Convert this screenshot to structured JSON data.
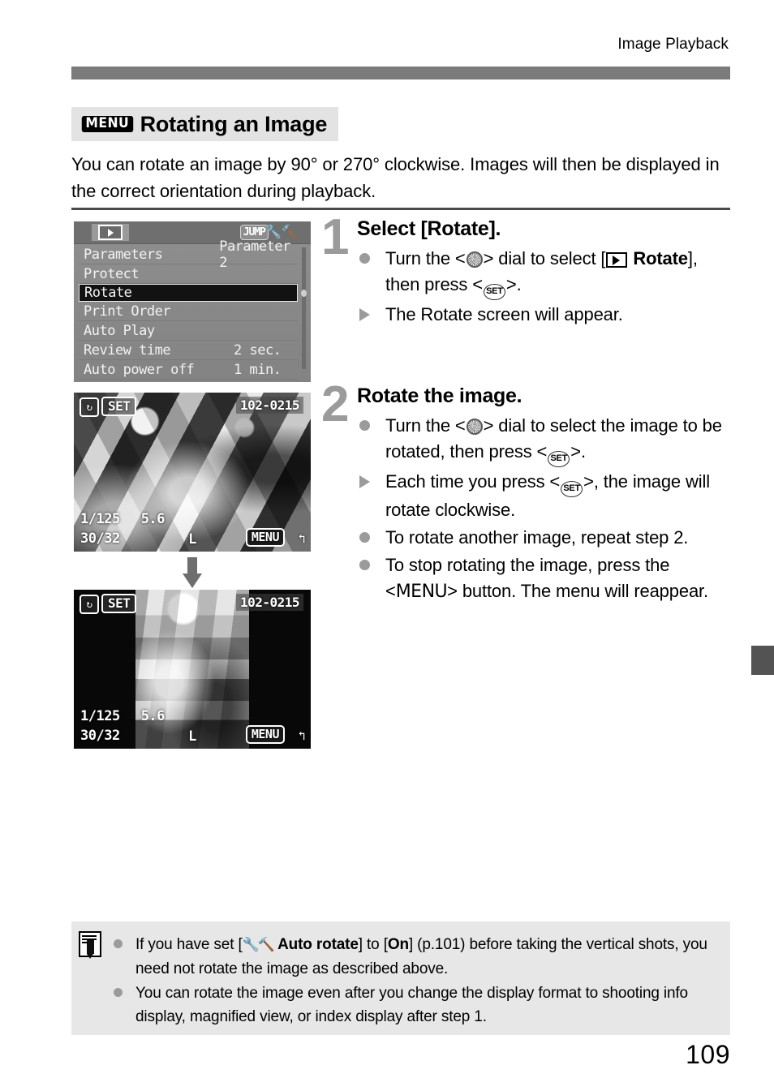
{
  "page": {
    "running_head": "Image Playback",
    "number": "109"
  },
  "section": {
    "menu_badge": "MENU",
    "title": "Rotating an Image",
    "intro": "You can rotate an image by 90° or 270° clockwise. Images will then be displayed in the correct orientation during playback."
  },
  "figures": {
    "menu_screen": {
      "tab_playback_icon": "playback-icon",
      "tab_jump": "JUMP",
      "tab_tools_icon": "setup-tools-icon",
      "rows": [
        {
          "label": "Parameters",
          "value": "Parameter 2",
          "selected": false
        },
        {
          "label": "Protect",
          "value": "",
          "selected": false
        },
        {
          "label": "Rotate",
          "value": "",
          "selected": true
        },
        {
          "label": "Print Order",
          "value": "",
          "selected": false
        },
        {
          "label": "Auto Play",
          "value": "",
          "selected": false
        },
        {
          "label": "Review time",
          "value": "2 sec.",
          "selected": false
        },
        {
          "label": "Auto power off",
          "value": "1 min.",
          "selected": false
        }
      ]
    },
    "photo_before": {
      "rotate_icon": "rotate-icon",
      "set_label": "SET",
      "file_number": "102-0215",
      "shutter": "1/125",
      "aperture": "5.6",
      "counter": "30/32",
      "quality": "L",
      "menu_label": "MENU",
      "back_icon": "return-icon"
    },
    "photo_after": {
      "rotate_icon": "rotate-icon",
      "set_label": "SET",
      "file_number": "102-0215",
      "shutter": "1/125",
      "aperture": "5.6",
      "counter": "30/32",
      "quality": "L",
      "menu_label": "MENU",
      "back_icon": "return-icon"
    },
    "transition_arrow": "down-arrow-icon"
  },
  "steps": [
    {
      "number": "1",
      "title": "Select [Rotate].",
      "bullets": [
        {
          "marker": "dot",
          "parts": [
            {
              "t": "text",
              "v": "Turn the <"
            },
            {
              "t": "glyph",
              "v": "dial-icon"
            },
            {
              "t": "text",
              "v": "> dial to select ["
            },
            {
              "t": "glyph",
              "v": "playback-icon"
            },
            {
              "t": "bold",
              "v": " Rotate"
            },
            {
              "t": "text",
              "v": "], then press <"
            },
            {
              "t": "glyph",
              "v": "set-icon"
            },
            {
              "t": "text",
              "v": ">."
            }
          ]
        },
        {
          "marker": "triangle",
          "parts": [
            {
              "t": "text",
              "v": "The Rotate screen will appear."
            }
          ]
        }
      ]
    },
    {
      "number": "2",
      "title": "Rotate the image.",
      "bullets": [
        {
          "marker": "dot",
          "parts": [
            {
              "t": "text",
              "v": "Turn the <"
            },
            {
              "t": "glyph",
              "v": "dial-icon"
            },
            {
              "t": "text",
              "v": "> dial to select the image to be rotated, then press <"
            },
            {
              "t": "glyph",
              "v": "set-icon"
            },
            {
              "t": "text",
              "v": ">."
            }
          ]
        },
        {
          "marker": "triangle",
          "parts": [
            {
              "t": "text",
              "v": "Each time you press <"
            },
            {
              "t": "glyph",
              "v": "set-icon"
            },
            {
              "t": "text",
              "v": ">, the image will rotate clockwise."
            }
          ]
        },
        {
          "marker": "dot",
          "parts": [
            {
              "t": "text",
              "v": "To rotate another image, repeat step 2."
            }
          ]
        },
        {
          "marker": "dot",
          "parts": [
            {
              "t": "text",
              "v": "To stop rotating the image, press the <"
            },
            {
              "t": "menuword",
              "v": "MENU"
            },
            {
              "t": "text",
              "v": "> button. The menu will reappear."
            }
          ]
        }
      ]
    }
  ],
  "note": {
    "icon": "note-pencil-icon",
    "items": [
      {
        "parts": [
          {
            "t": "text",
            "v": "If you have set ["
          },
          {
            "t": "glyph",
            "v": "setup-tools-icon"
          },
          {
            "t": "bold",
            "v": " Auto rotate"
          },
          {
            "t": "text",
            "v": "] to ["
          },
          {
            "t": "bold",
            "v": "On"
          },
          {
            "t": "text",
            "v": "] (p.101) before taking the vertical shots, you need not rotate the image as described above."
          }
        ]
      },
      {
        "parts": [
          {
            "t": "text",
            "v": "You can rotate the image even after you change the display format to shooting info display, magnified view, or index display after step 1."
          }
        ]
      }
    ]
  },
  "colors": {
    "header_rule": "#7b7b7b",
    "heading_bg": "#e3e3e3",
    "note_bg": "#e7e7e7",
    "marker_gray": "#9b9b9b",
    "side_tab": "#535353"
  }
}
